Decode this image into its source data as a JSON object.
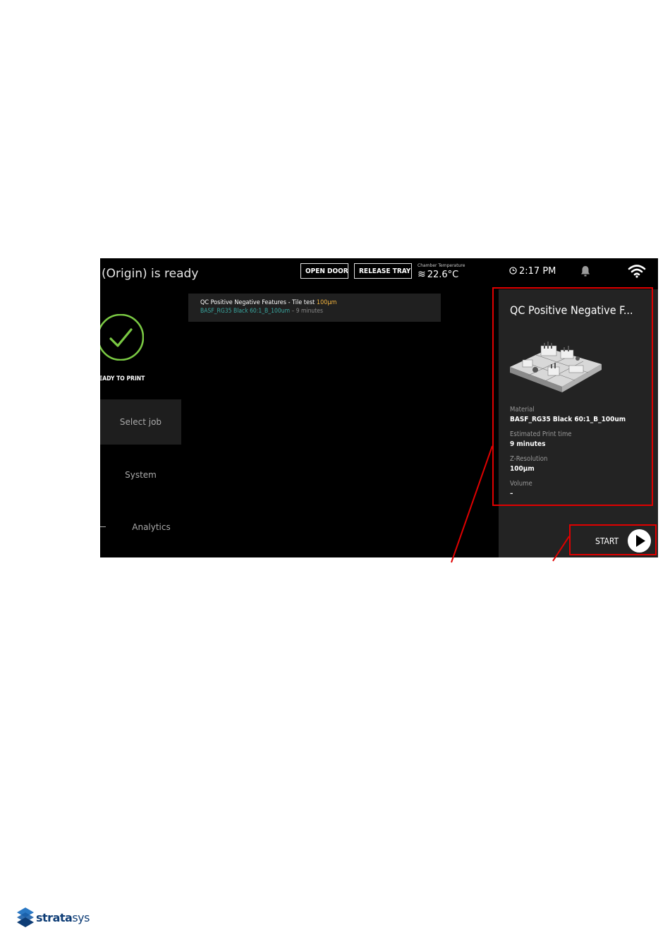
{
  "screen": {
    "title": "(Origin) is ready",
    "open_door": "OPEN DOOR",
    "release_tray": "RELEASE TRAY",
    "chamber_label": "Chamber Temperature",
    "chamber_temp": "22.6°C",
    "time": "2:17 PM",
    "status": "EADY TO PRINT",
    "nav": {
      "select_job": "Select job",
      "system": "System",
      "analytics": "Analytics"
    }
  },
  "job": {
    "title": "QC Positive Negative Features - Tile test",
    "resolution": "100µm",
    "material": "BASF_RG35 Black 60:1_B_100um",
    "duration": " – 9 minutes"
  },
  "panel": {
    "name": "QC Positive Negative F...",
    "material_label": "Material",
    "material_value": "BASF_RG35 Black 60:1_B_100um",
    "time_label": "Estimated Print time",
    "time_value": "9 minutes",
    "zres_label": "Z-Resolution",
    "zres_value": "100µm",
    "volume_label": "Volume",
    "volume_value": "–",
    "start": "START"
  },
  "logo": {
    "bold": "strata",
    "light": "sys"
  },
  "colors": {
    "accent_green": "#7ac943",
    "highlight_red": "#e00000",
    "resolution_yellow": "#f2b33d",
    "material_teal": "#3aa7a0"
  }
}
